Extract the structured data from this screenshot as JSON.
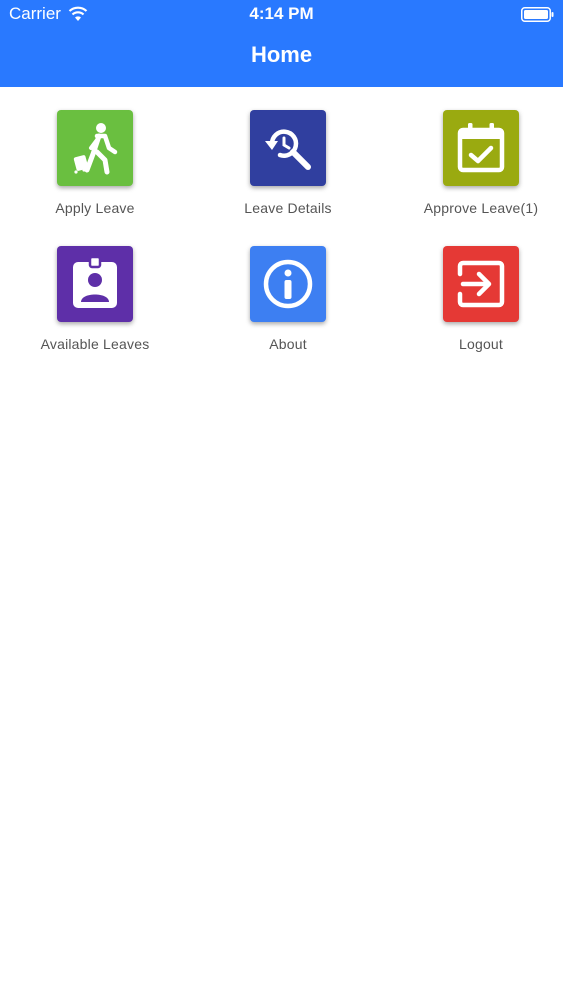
{
  "status_bar": {
    "carrier": "Carrier",
    "time": "4:14 PM"
  },
  "nav": {
    "title": "Home"
  },
  "colors": {
    "primary": "#2979ff"
  },
  "tiles": [
    {
      "label": "Apply Leave",
      "icon": "walking-with-luggage-icon",
      "color": "#6abf40"
    },
    {
      "label": "Leave Details",
      "icon": "search-history-icon",
      "color": "#303f9f"
    },
    {
      "label": "Approve Leave(1)",
      "icon": "calendar-check-icon",
      "color": "#9aaa10"
    },
    {
      "label": "Available Leaves",
      "icon": "id-badge-icon",
      "color": "#5e2fa8"
    },
    {
      "label": "About",
      "icon": "info-icon",
      "color": "#3d7ff2"
    },
    {
      "label": "Logout",
      "icon": "exit-icon",
      "color": "#e53935"
    }
  ]
}
